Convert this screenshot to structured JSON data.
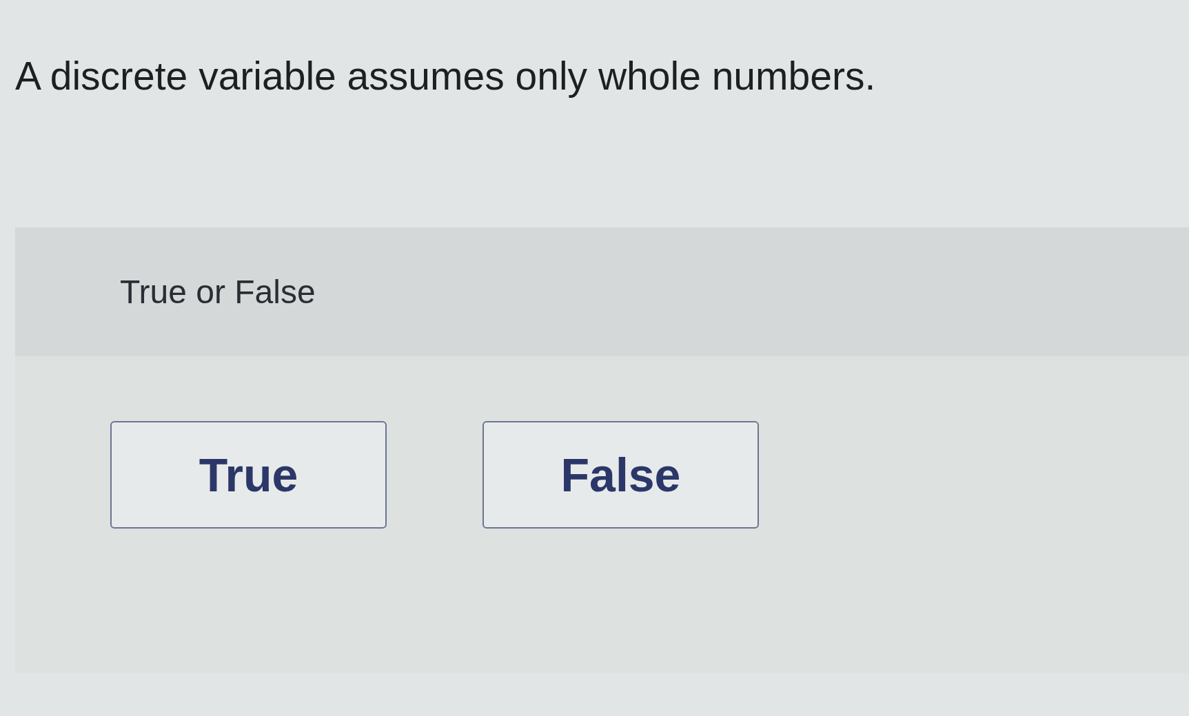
{
  "question": {
    "text": "A discrete variable assumes only whole numbers."
  },
  "answer_panel": {
    "prompt": "True or False",
    "choices": [
      {
        "label": "True",
        "selected": false
      },
      {
        "label": "False",
        "selected": false
      }
    ]
  }
}
